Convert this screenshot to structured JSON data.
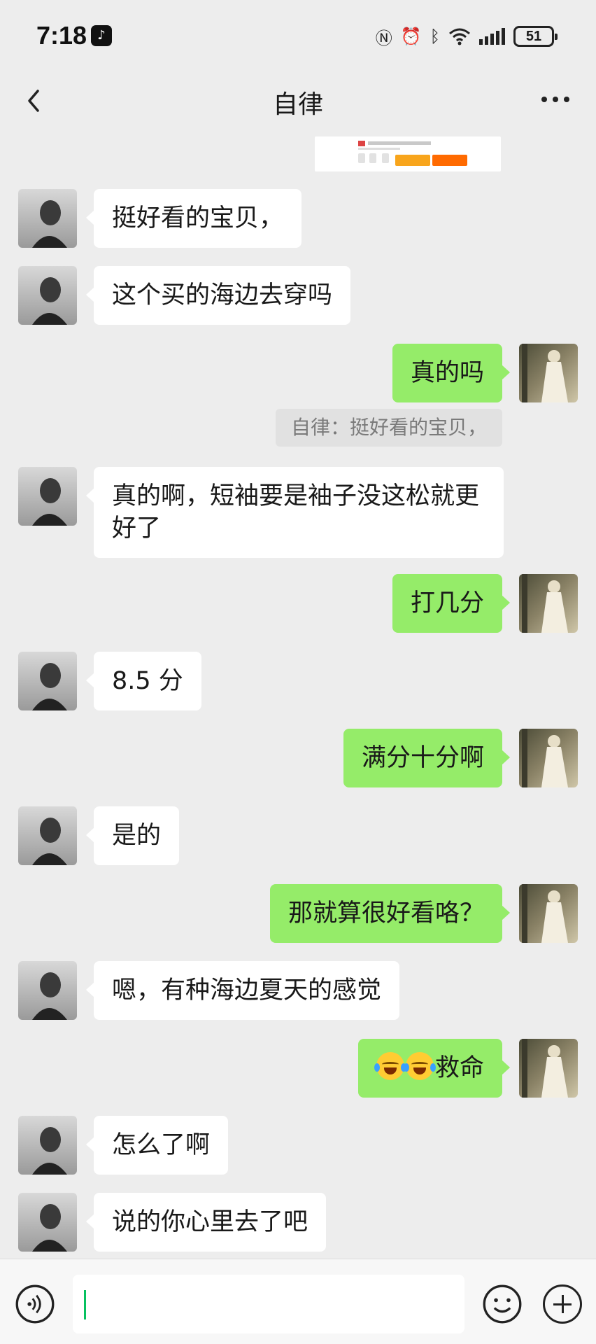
{
  "status_bar": {
    "time": "7:18",
    "battery": "51",
    "icons": [
      "tiktok-icon",
      "nfc-icon",
      "alarm-icon",
      "bluetooth-icon",
      "wifi-icon",
      "signal-icon",
      "battery-icon"
    ]
  },
  "header": {
    "title": "自律",
    "back_icon": "back-chevron-icon",
    "more_icon": "more-dots-icon"
  },
  "messages": [
    {
      "side": "in",
      "text": "挺好看的宝贝，"
    },
    {
      "side": "in",
      "text": "这个买的海边去穿吗"
    },
    {
      "side": "out",
      "text": "真的吗"
    },
    {
      "side": "in",
      "text": "真的啊，短袖要是袖子没这松就更好了"
    },
    {
      "side": "out",
      "text": "打几分"
    },
    {
      "side": "in",
      "text": "8.5 分"
    },
    {
      "side": "out",
      "text": "满分十分啊"
    },
    {
      "side": "in",
      "text": "是的"
    },
    {
      "side": "out",
      "text": "那就算很好看咯？"
    },
    {
      "side": "in",
      "text": "嗯，有种海边夏天的感觉"
    },
    {
      "side": "out",
      "text": "救命",
      "emojis": [
        "laugh-cry-emoji",
        "laugh-cry-emoji"
      ]
    },
    {
      "side": "in",
      "text": "怎么了啊"
    },
    {
      "side": "in",
      "text": "说的你心里去了吧"
    }
  ],
  "quote": {
    "text": "自律：挺好看的宝贝，"
  },
  "input_bar": {
    "voice_icon": "voice-icon",
    "emoji_icon": "emoji-icon",
    "plus_icon": "plus-icon",
    "value": ""
  },
  "colors": {
    "background": "#ededed",
    "outgoing_bubble": "#95ec69",
    "incoming_bubble": "#ffffff",
    "caret": "#07c160"
  }
}
